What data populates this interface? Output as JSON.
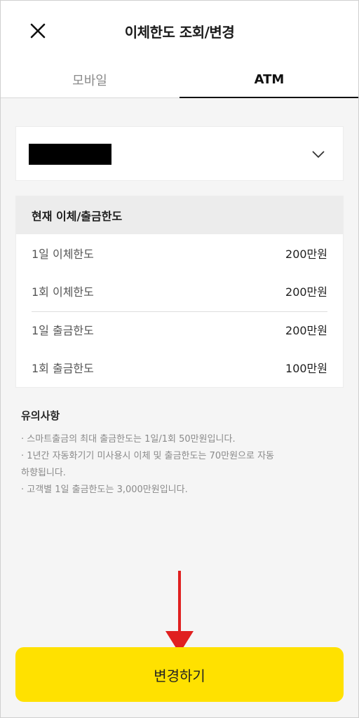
{
  "header": {
    "title": "이체한도 조회/변경",
    "close_icon": "close-icon"
  },
  "tabs": [
    {
      "label": "모바일",
      "active": false
    },
    {
      "label": "ATM",
      "active": true
    }
  ],
  "account_select": {
    "value_redacted": true,
    "icon": "chevron-down-icon"
  },
  "limits": {
    "heading": "현재 이체/출금한도",
    "rows": [
      {
        "label": "1일 이체한도",
        "value": "200만원"
      },
      {
        "label": "1회 이체한도",
        "value": "200만원"
      },
      {
        "label": "1일 출금한도",
        "value": "200만원"
      },
      {
        "label": "1회 출금한도",
        "value": "100만원"
      }
    ]
  },
  "notice": {
    "title": "유의사항",
    "lines": [
      "· 스마트출금의 최대 출금한도는 1일/1회 50만원입니다.",
      "· 1년간 자동화기기 미사용시 이체 및 출금한도는 70만원으로 자동",
      "  하향됩니다.",
      "· 고객별 1일 출금한도는 3,000만원입니다."
    ]
  },
  "change_button": {
    "label": "변경하기",
    "color": "#ffe100"
  },
  "annotation": {
    "arrow_color": "#e02020"
  }
}
